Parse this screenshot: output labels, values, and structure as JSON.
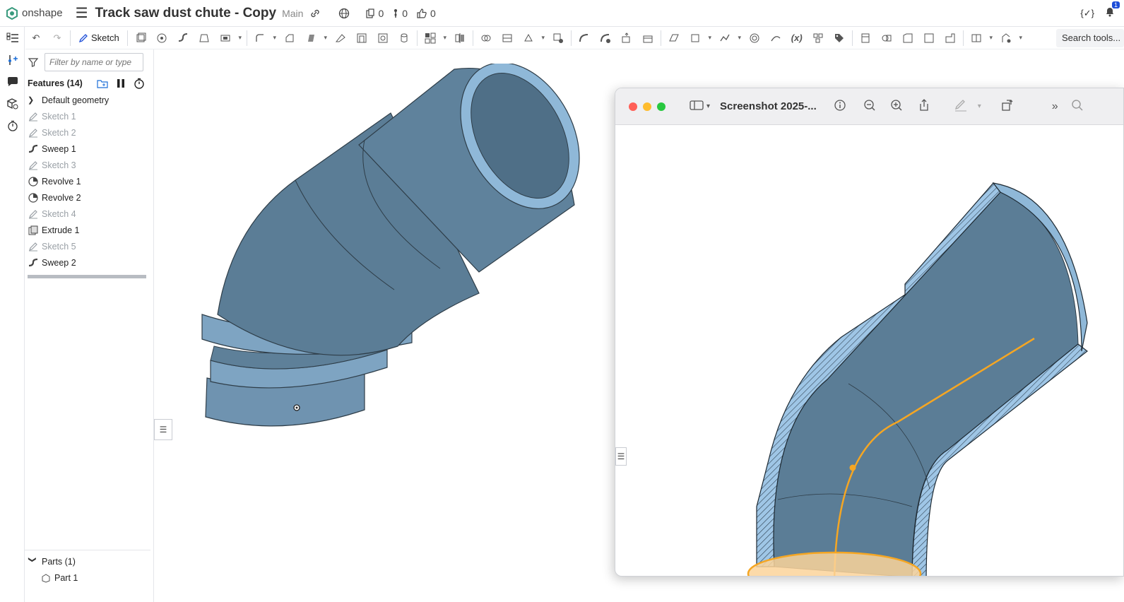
{
  "app": {
    "logo_text": "onshape",
    "doc_title": "Track saw dust chute - Copy",
    "branch": "Main"
  },
  "topbar": {
    "versions_count": "0",
    "branches_count": "0",
    "likes_count": "0",
    "notification_count": "1",
    "code_label": "{✓}"
  },
  "toolbar": {
    "sketch_label": "Sketch",
    "search_label": "Search tools..."
  },
  "panel": {
    "filter_placeholder": "Filter by name or type",
    "features_title": "Features (14)",
    "default_geometry": "Default geometry",
    "features": [
      {
        "label": "Sketch 1",
        "type": "sketch"
      },
      {
        "label": "Sketch 2",
        "type": "sketch"
      },
      {
        "label": "Sweep 1",
        "type": "sweep"
      },
      {
        "label": "Sketch 3",
        "type": "sketch"
      },
      {
        "label": "Revolve 1",
        "type": "revolve"
      },
      {
        "label": "Revolve 2",
        "type": "revolve"
      },
      {
        "label": "Sketch 4",
        "type": "sketch"
      },
      {
        "label": "Extrude 1",
        "type": "extrude"
      },
      {
        "label": "Sketch 5",
        "type": "sketch"
      },
      {
        "label": "Sweep 2",
        "type": "sweep"
      }
    ],
    "parts_title": "Parts (1)",
    "parts": [
      {
        "label": "Part 1"
      }
    ]
  },
  "preview": {
    "title": "Screenshot 2025-..."
  },
  "colors": {
    "model_fill": "#5b7d96",
    "model_light": "#8fb8d8",
    "highlight": "#f5a623",
    "highlight_fill": "#fbd49a"
  }
}
